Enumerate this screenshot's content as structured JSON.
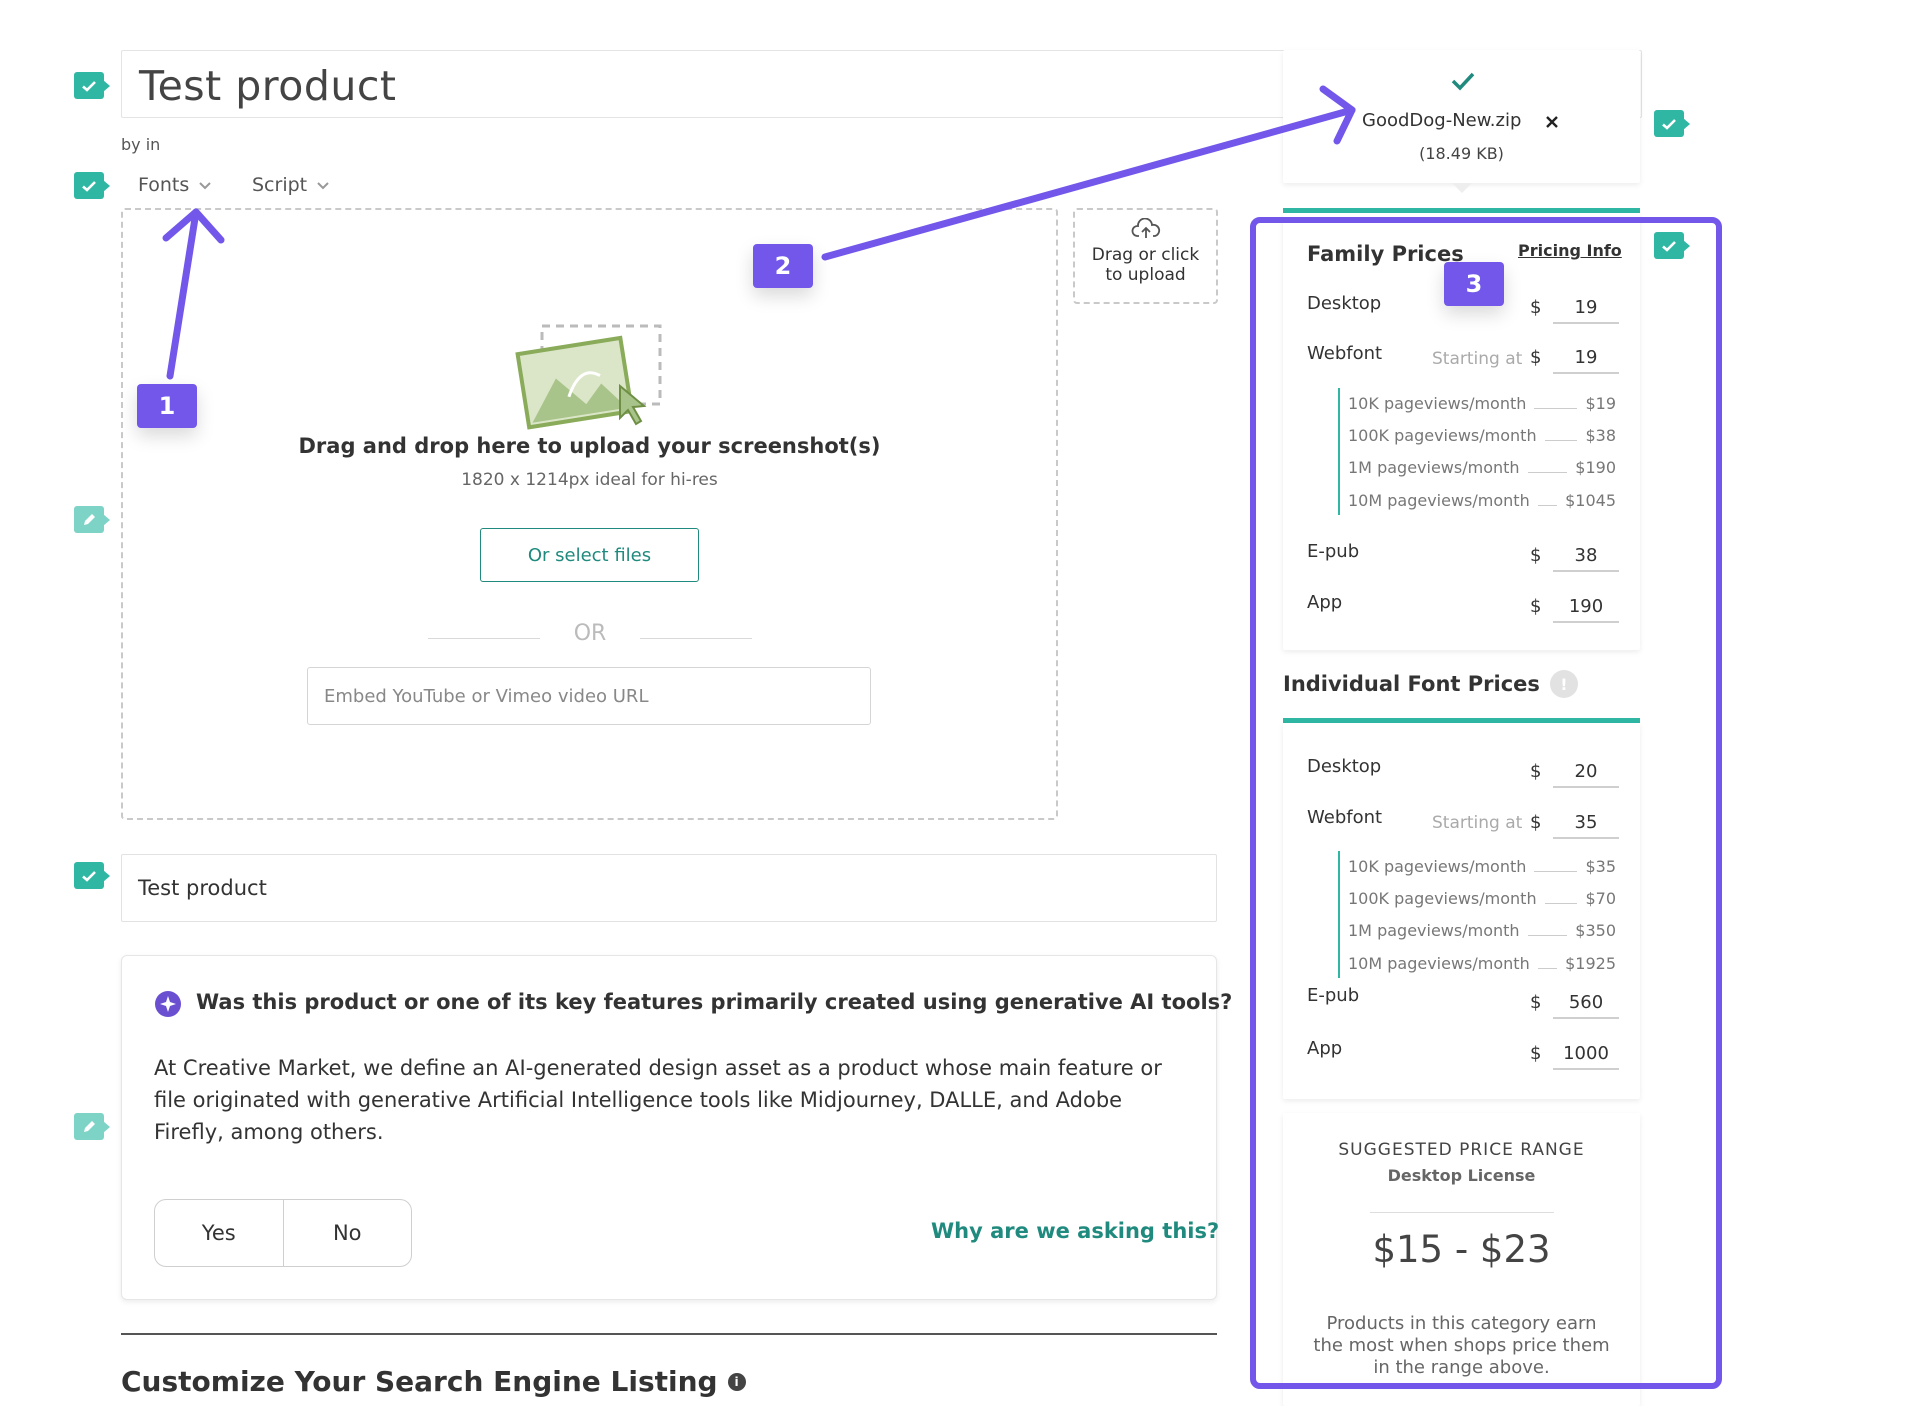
{
  "product": {
    "title": "Test product",
    "byline": "by in",
    "fonts_label": "Fonts",
    "script_label": "Script",
    "name_value": "Test product"
  },
  "upload": {
    "drag_title": "Drag and drop here to upload your screenshot(s)",
    "drag_subtitle": "1820 x 1214px ideal for hi-res",
    "select_button": "Or select files",
    "or_text": "OR",
    "embed_placeholder": "Embed YouTube or Vimeo video URL",
    "small_upload_line1": "Drag or click",
    "small_upload_line2": "to upload"
  },
  "file": {
    "name": "GoodDog-New.zip",
    "size": "(18.49 KB)"
  },
  "ai_question": {
    "question": "Was this product or one of its key features primarily created using generative AI tools?",
    "body": "At Creative Market, we define an AI-generated design asset as a product whose main feature or file originated with generative Artificial Intelligence tools like Midjourney, DALLE, and Adobe Firefly, among others.",
    "yes_label": "Yes",
    "no_label": "No",
    "why_link": "Why are we asking this?"
  },
  "seo": {
    "title": "Customize Your Search Engine Listing"
  },
  "family_prices": {
    "title": "Family Prices",
    "pricing_info_link": "Pricing Info",
    "currency": "$",
    "starting_at": "Starting at",
    "desktop_label": "Desktop",
    "desktop_value": "19",
    "webfont_label": "Webfont",
    "webfont_value": "19",
    "tiers": [
      {
        "label": "10K pageviews/month",
        "amount": "$19"
      },
      {
        "label": "100K pageviews/month",
        "amount": "$38"
      },
      {
        "label": "1M pageviews/month",
        "amount": "$190"
      },
      {
        "label": "10M pageviews/month",
        "amount": "$1045"
      }
    ],
    "epub_label": "E-pub",
    "epub_value": "38",
    "app_label": "App",
    "app_value": "190"
  },
  "individual_prices": {
    "title": "Individual Font Prices",
    "currency": "$",
    "starting_at": "Starting at",
    "desktop_label": "Desktop",
    "desktop_value": "20",
    "webfont_label": "Webfont",
    "webfont_value": "35",
    "tiers": [
      {
        "label": "10K pageviews/month",
        "amount": "$35"
      },
      {
        "label": "100K pageviews/month",
        "amount": "$70"
      },
      {
        "label": "1M pageviews/month",
        "amount": "$350"
      },
      {
        "label": "10M pageviews/month",
        "amount": "$1925"
      }
    ],
    "epub_label": "E-pub",
    "epub_value": "560",
    "app_label": "App",
    "app_value": "1000"
  },
  "suggested": {
    "title": "SUGGESTED PRICE RANGE",
    "subtitle": "Desktop License",
    "range": "$15 - $23",
    "note": "Products in this category earn the most when shops price them in the range above."
  },
  "annotations": {
    "badge1": "1",
    "badge2": "2",
    "badge3": "3"
  },
  "colors": {
    "teal": "#2fb7a4",
    "teal_dark": "#1f8a7d",
    "annotation_purple": "#7257ea"
  }
}
